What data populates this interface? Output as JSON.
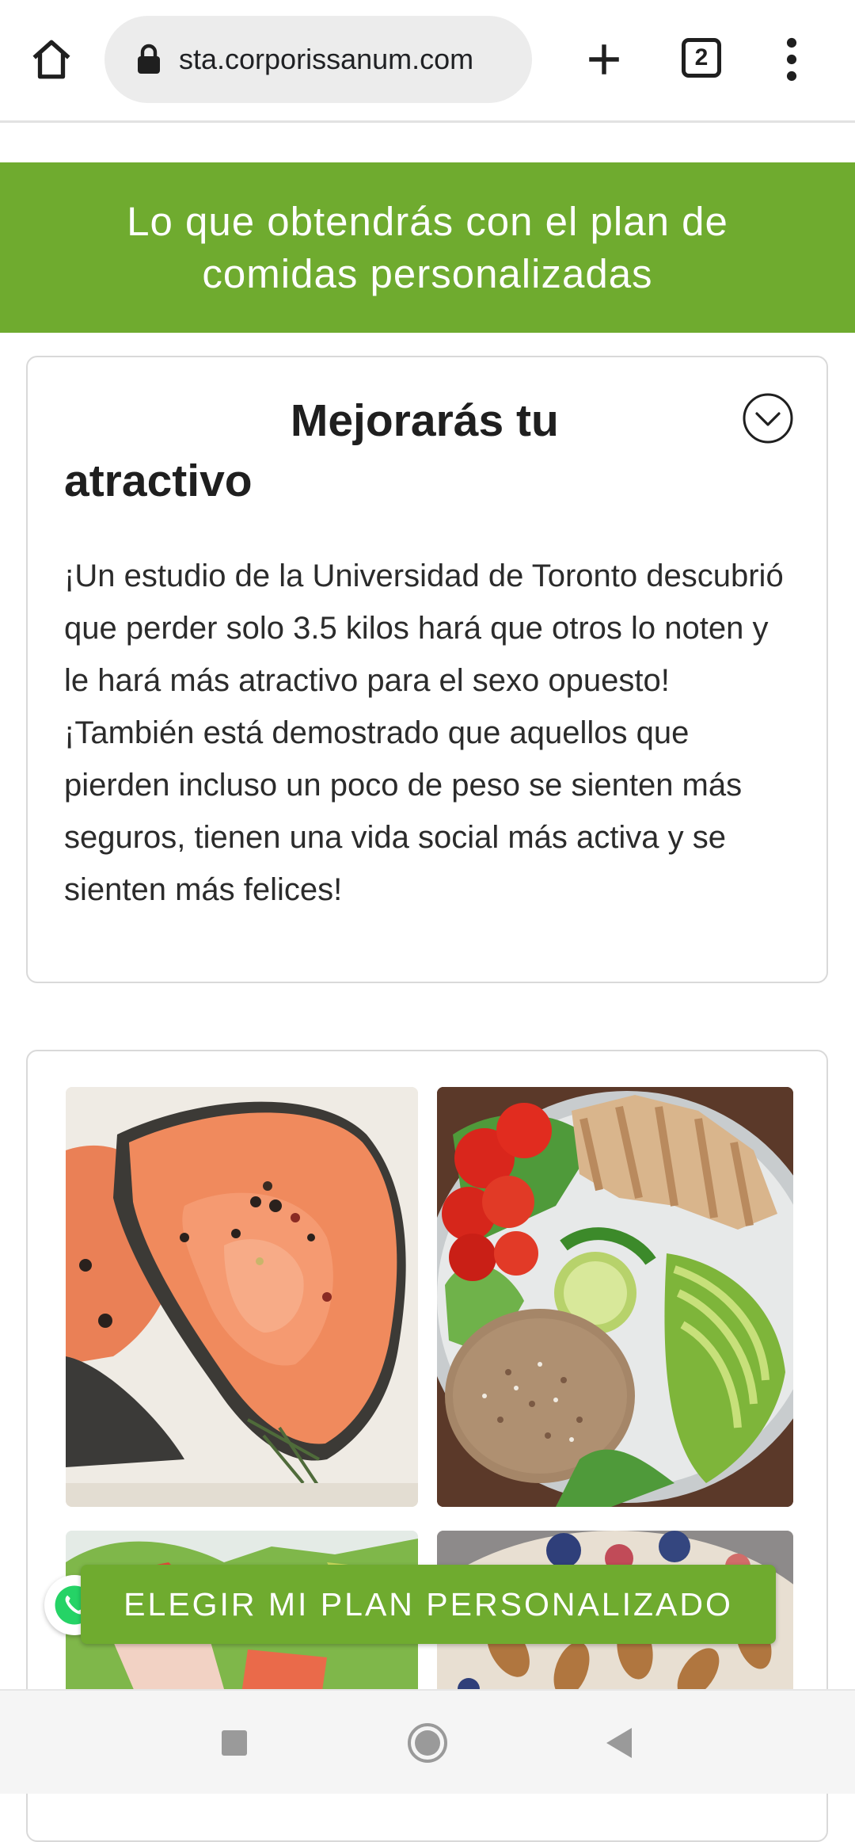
{
  "browser": {
    "url": "sta.corporissanum.com",
    "tab_count": "2",
    "icons": [
      "home-icon",
      "lock-icon",
      "plus-icon",
      "tabs-icon",
      "more-vert-icon"
    ]
  },
  "banner": {
    "title": "Lo que obtendrás con el plan de comidas personalizadas",
    "bg_color": "#6fab2f"
  },
  "benefit_card": {
    "title": "Mejorarás tu atractivo",
    "body": "¡Un estudio de la Universidad de Toronto descubrió que perder solo 3.5 kilos hará que otros lo noten y le hará más atractivo para el sexo opuesto! ¡También está demostrado que aquellos que pierden incluso un poco de peso se sienten más seguros, tienen una vida social más activa y se sienten más felices!",
    "toggle_icon": "chevron-down-circle-icon"
  },
  "gallery": {
    "images": [
      "salmon-steak",
      "chicken-quinoa-bowl",
      "salad",
      "oat-bowl-nuts"
    ]
  },
  "cta": {
    "label": "ELEGIR MI PLAN PERSONALIZADO",
    "color": "#6fab2f"
  },
  "nav": {
    "icons": [
      "recents-icon",
      "home-icon",
      "back-icon"
    ]
  }
}
